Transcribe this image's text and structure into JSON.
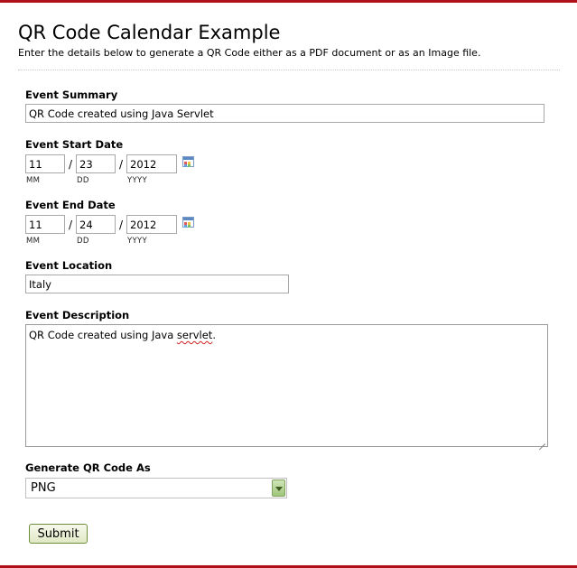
{
  "header": {
    "title": "QR Code Calendar Example",
    "subtitle": "Enter the details below to generate a QR Code either as a PDF document or as an Image file."
  },
  "form": {
    "summary": {
      "label": "Event Summary",
      "value": "QR Code created using Java Servlet"
    },
    "start_date": {
      "label": "Event Start Date",
      "mm": "11",
      "dd": "23",
      "yyyy": "2012"
    },
    "end_date": {
      "label": "Event End Date",
      "mm": "11",
      "dd": "24",
      "yyyy": "2012"
    },
    "date_sublabels": {
      "mm": "MM",
      "dd": "DD",
      "yyyy": "YYYY"
    },
    "date_separator": "/",
    "location": {
      "label": "Event Location",
      "value": "Italy"
    },
    "description": {
      "label": "Event Description",
      "text_before": "QR Code created using Java ",
      "misspelled": "servlet",
      "text_after": "."
    },
    "format": {
      "label": "Generate QR Code As",
      "selected": "PNG"
    },
    "submit_label": "Submit"
  },
  "icons": {
    "calendar": "calendar-icon",
    "dropdown": "chevron-down-icon",
    "resize": "resize-grip-icon"
  },
  "colors": {
    "accent_bar": "#b0101a",
    "select_button": "#9fc57a",
    "submit_border": "#6e8f3a"
  }
}
